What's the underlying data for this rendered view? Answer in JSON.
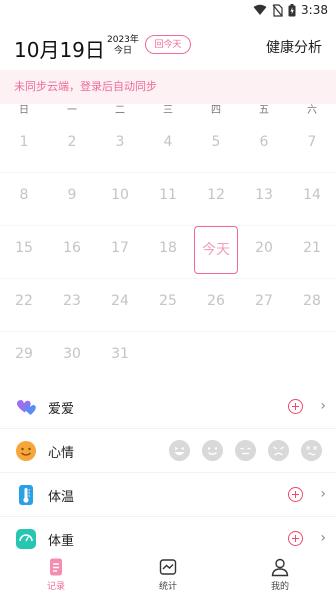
{
  "status": {
    "time": "3:38"
  },
  "header": {
    "date": "10月19日",
    "year": "2023年",
    "day_word": "今日",
    "back_today": "回今天",
    "analysis": "健康分析"
  },
  "sync_banner": "未同步云端，登录后自动同步",
  "weekdays": [
    "日",
    "一",
    "二",
    "三",
    "四",
    "五",
    "六"
  ],
  "calendar": {
    "rows": [
      [
        "1",
        "2",
        "3",
        "4",
        "5",
        "6",
        "7"
      ],
      [
        "8",
        "9",
        "10",
        "11",
        "12",
        "13",
        "14"
      ],
      [
        "15",
        "16",
        "17",
        "18",
        "今天",
        "20",
        "21"
      ],
      [
        "22",
        "23",
        "24",
        "25",
        "26",
        "27",
        "28"
      ],
      [
        "29",
        "30",
        "31",
        "",
        "",
        "",
        ""
      ]
    ]
  },
  "records": {
    "love": "爱爱",
    "mood": "心情",
    "temperature": "体温",
    "weight": "体重"
  },
  "tabs": {
    "record": "记录",
    "stats": "统计",
    "mine": "我的"
  },
  "colors": {
    "accent": "#f06a9a",
    "add": "#ec4a6e"
  }
}
